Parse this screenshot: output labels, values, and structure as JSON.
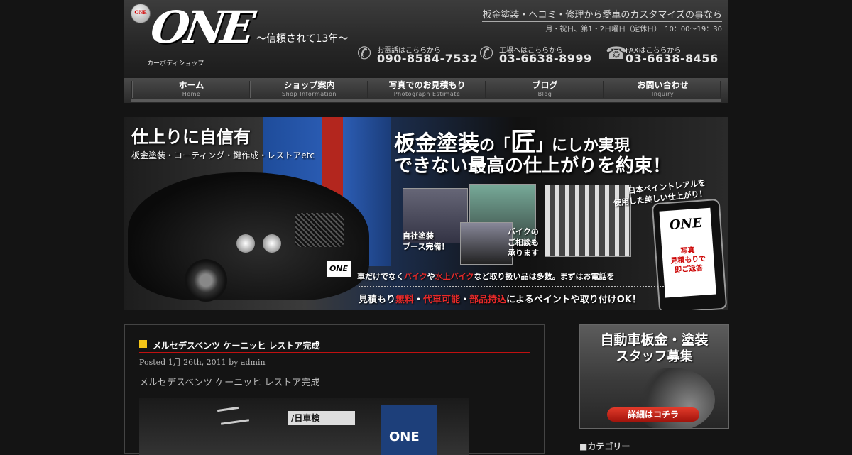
{
  "header": {
    "logo_badge": "ONE",
    "logo_text": "ONE",
    "logo_sub": "カーボディショップ",
    "tagline": "〜信頼されて13年〜",
    "top_link": "板金塗装・ヘコミ・修理から愛車のカスタマイズの事なら",
    "hours": "月・祝日、第1・2日曜日（定休日）　10：00～19：30",
    "contacts": [
      {
        "label": "お電話はこちらから",
        "number": "090-8584-7532",
        "icon": "phone-icon"
      },
      {
        "label": "工場へはこちらから",
        "number": "03-6638-8999",
        "icon": "phone-icon"
      },
      {
        "label": "FAXはこちらから",
        "number": "03-6638-8456",
        "icon": "fax-icon"
      }
    ]
  },
  "nav": [
    {
      "jp": "ホーム",
      "en": "Home"
    },
    {
      "jp": "ショップ案内",
      "en": "Shop Information"
    },
    {
      "jp": "写真でのお見積もり",
      "en": "Photograph Estimate"
    },
    {
      "jp": "ブログ",
      "en": "Blog"
    },
    {
      "jp": "お問い合わせ",
      "en": "Inquiry"
    }
  ],
  "banner": {
    "left_title": "仕上りに自信有",
    "left_sub": "板金塗装・コーティング・鍵作成・レストアetc",
    "main_a": "板金塗装",
    "main_b": "の「",
    "main_c": "匠",
    "main_d": "」にしか実現",
    "main_line2": "できない最高の仕上がりを約束！",
    "caption1": "自社塗装\nブース完備！",
    "caption2": "バイクの\nご相談も\n承ります",
    "caption3": "日本ペイントレアルを\n使用した美しい仕上がり！",
    "phone_logo": "ONE",
    "phone_text": "写真\n見積もりで\n即ご返答",
    "plate": "ONE",
    "line1_a": "車だけでなく",
    "line1_b": "バイク",
    "line1_c": "や",
    "line1_d": "水上バイク",
    "line1_e": "など取り扱い品は多数。まずはお電話を",
    "line2_a": "見積もり",
    "line2_b": "無料",
    "line2_c": "・",
    "line2_d": "代車可能",
    "line2_e": "・",
    "line2_f": "部品持込",
    "line2_g": "によるペイントや取り付けOK！"
  },
  "post": {
    "title": "メルセデスベンツ ケーニッヒ レストア完成",
    "meta": "Posted 1月 26th, 2011 by admin",
    "body": "メルセデスベンツ ケーニッヒ レストア完成",
    "img_sign": "ONE",
    "img_sign2": "/日車検"
  },
  "sidebar": {
    "recruit_line1": "自動車板金・塗装",
    "recruit_line2": "スタッフ募集",
    "recruit_button": "詳細はコチラ",
    "category_heading": "■カテゴリー"
  }
}
